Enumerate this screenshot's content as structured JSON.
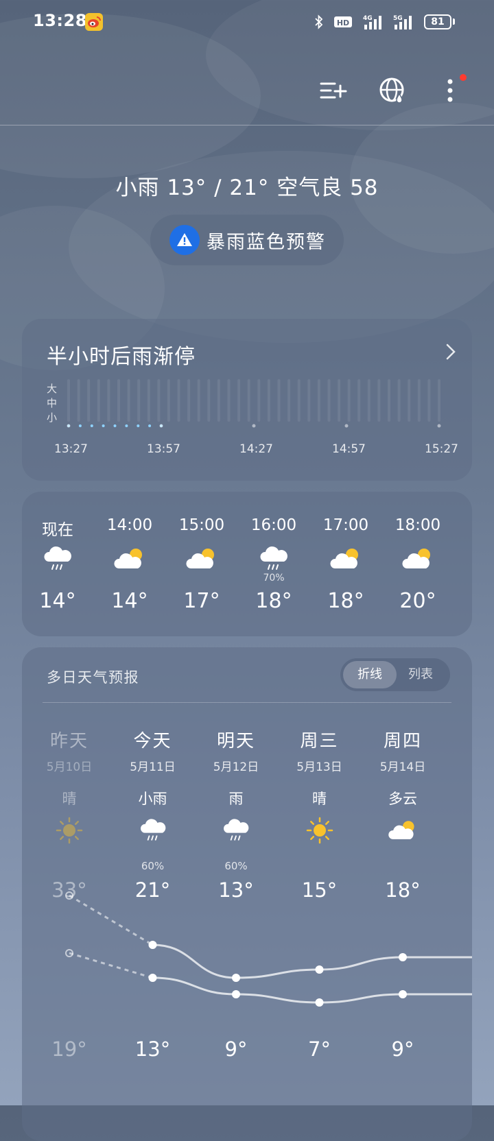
{
  "status_bar": {
    "time": "13:28",
    "battery": "81",
    "network_1": "4G",
    "network_2": "5G",
    "hd_badge": "HD"
  },
  "toolbar": {
    "city_manage_icon": "list-add-icon",
    "globe_icon": "globe-icon",
    "more_icon": "more-vertical-icon"
  },
  "summary": {
    "text": "小雨 13° / 21° 空气良 58"
  },
  "alert": {
    "label": "暴雨蓝色预警",
    "color": "#1f6fe5"
  },
  "rain_forecast": {
    "title": "半小时后雨渐停",
    "levels": [
      "大",
      "中",
      "小"
    ],
    "ticks": [
      "13:27",
      "13:57",
      "14:27",
      "14:57",
      "15:27"
    ],
    "rain_until_fraction": 0.25
  },
  "hourly": [
    {
      "time": "现在",
      "icon": "rain-cloud-icon",
      "prob": "",
      "temp": "14°"
    },
    {
      "time": "14:00",
      "icon": "partly-cloudy-icon",
      "prob": "",
      "temp": "14°"
    },
    {
      "time": "15:00",
      "icon": "partly-cloudy-icon",
      "prob": "",
      "temp": "17°"
    },
    {
      "time": "16:00",
      "icon": "rain-cloud-icon",
      "prob": "70%",
      "temp": "18°"
    },
    {
      "time": "17:00",
      "icon": "partly-cloudy-icon",
      "prob": "",
      "temp": "18°"
    },
    {
      "time": "18:00",
      "icon": "partly-cloudy-icon",
      "prob": "",
      "temp": "20°"
    }
  ],
  "daily": {
    "title": "多日天气预报",
    "toggle": {
      "active": "折线",
      "inactive": "列表"
    },
    "days": [
      {
        "name": "昨天",
        "date": "5月10日",
        "cond": "晴",
        "icon": "sun-icon",
        "prob": "",
        "high": "33°",
        "low": "19°",
        "high_value": 33,
        "low_value": 19,
        "past": true
      },
      {
        "name": "今天",
        "date": "5月11日",
        "cond": "小雨",
        "icon": "rain-cloud-icon",
        "prob": "60%",
        "high": "21°",
        "low": "13°",
        "high_value": 21,
        "low_value": 13,
        "past": false
      },
      {
        "name": "明天",
        "date": "5月12日",
        "cond": "雨",
        "icon": "rain-cloud-icon",
        "prob": "60%",
        "high": "13°",
        "low": "9°",
        "high_value": 13,
        "low_value": 9,
        "past": false
      },
      {
        "name": "周三",
        "date": "5月13日",
        "cond": "晴",
        "icon": "sun-icon",
        "prob": "",
        "high": "15°",
        "low": "7°",
        "high_value": 15,
        "low_value": 7,
        "past": false
      },
      {
        "name": "周四",
        "date": "5月14日",
        "cond": "多云",
        "icon": "partly-cloudy-icon",
        "prob": "",
        "high": "18°",
        "low": "9°",
        "high_value": 18,
        "low_value": 9,
        "past": false
      }
    ]
  },
  "colors": {
    "sun": "#f8c22c",
    "rain_dot": "#8fd3ff",
    "alert": "#1f6fe5",
    "notify": "#ff3b30"
  }
}
